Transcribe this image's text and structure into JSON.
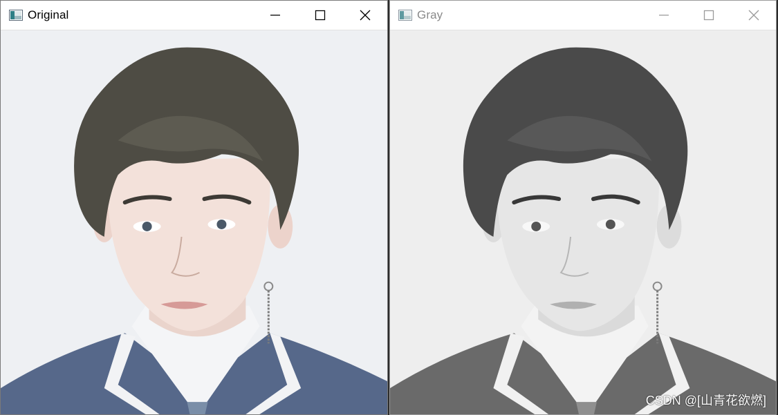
{
  "windows": [
    {
      "title": "Original",
      "icon": "opencv-window-icon",
      "active": true
    },
    {
      "title": "Gray",
      "icon": "opencv-window-icon",
      "active": false
    }
  ],
  "colors": {
    "active_title": "#000000",
    "inactive_title": "#8a8a8a",
    "original_background": "#eef0f3",
    "gray_background": "#eeeeee"
  },
  "watermark": "CSDN @[山青花欲燃]"
}
